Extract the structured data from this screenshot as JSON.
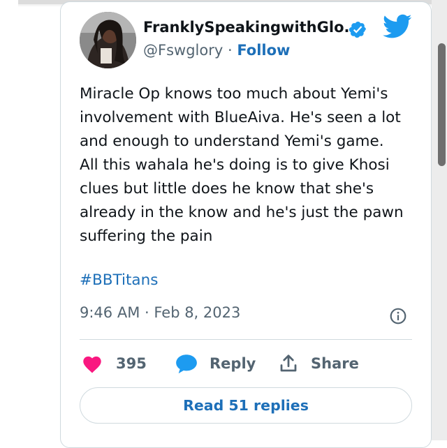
{
  "tweet": {
    "author_name": "FranklySpeakingwithGlo...",
    "handle": "@Fswglory",
    "separator": " · ",
    "follow_label": "Follow",
    "text_lines": [
      "Miracle Op knows too much about Yemi's",
      "involvement with BlueAiva. He's seen a lot",
      "and enough to understand Yemi's game.",
      "All this wahala he's doing is to give Khosi",
      "clues but little does he know that she's",
      "already in the know and he's just the pawn",
      "suffering the pain"
    ],
    "hashtag": "#BBTitans",
    "timestamp": "9:46 AM · Feb 8, 2023"
  },
  "actions": {
    "likes_count": "395",
    "reply_label": "Reply",
    "share_label": "Share"
  },
  "read_replies_label": "Read 51 replies",
  "icons": {
    "verified": "verified-badge-icon",
    "twitter": "twitter-bird-icon",
    "info": "info-icon",
    "heart": "heart-icon",
    "reply": "reply-bubble-icon",
    "share": "share-upload-icon"
  },
  "colors": {
    "accent_blue": "#1d6fb8",
    "twitter_blue": "#1d9bf0",
    "heart_pink": "#f91880",
    "secondary_text": "#536471",
    "border": "#cfd9de"
  }
}
